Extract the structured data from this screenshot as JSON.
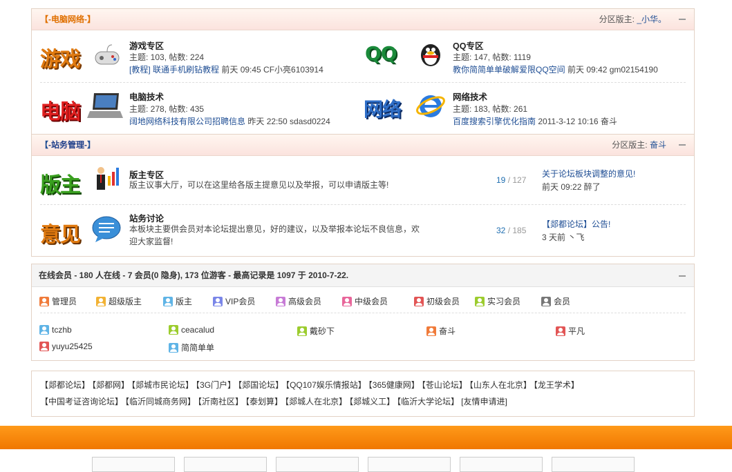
{
  "cat1": {
    "title": "-电脑网络-",
    "moderator_label": "分区版主:",
    "moderator": "_小华。",
    "forums": [
      {
        "icon": "游戏",
        "name": "游戏专区",
        "stats": "主题: 103, 帖数: 224",
        "last_link": "[教程] 联通手机刷钻教程",
        "last_time": "前天 09:45 CF小亮6103914"
      },
      {
        "icon": "QQ",
        "name": "QQ专区",
        "stats": "主题: 147, 帖数: 1119",
        "last_link": "教你简简单单破解爱限QQ空间",
        "last_time": "前天 09:42 gm02154190"
      },
      {
        "icon": "电脑",
        "name": "电脑技术",
        "stats": "主题: 278, 帖数: 435",
        "last_link": "阔地网络科技有限公司招聘信息",
        "last_time": "昨天 22:50 sdasd0224"
      },
      {
        "icon": "网络",
        "name": "网络技术",
        "stats": "主题: 183, 帖数: 261",
        "last_link": "百度搜索引擎优化指南",
        "last_time": "2011-3-12 10:16 奋斗"
      }
    ]
  },
  "cat2": {
    "title": "-站务管理-",
    "moderator_label": "分区版主:",
    "moderator": "奋斗",
    "forums": [
      {
        "icon": "版主",
        "name": "版主专区",
        "desc": "版主议事大厅，可以在这里给各版主提意见以及举报，可以申请版主等!",
        "threads": "19",
        "posts": "127",
        "last_link": "关于论坛板块调整的意见!",
        "last_time": "前天 09:22 醉了"
      },
      {
        "icon": "意见",
        "name": "站务讨论",
        "desc": "本板块主要供会员对本论坛提出意见，好的建议，以及举报本论坛不良信息，欢迎大家监督!",
        "threads": "32",
        "posts": "185",
        "last_link": "【郯都论坛】公告!",
        "last_time": "3 天前 丶飞"
      }
    ]
  },
  "online": {
    "title": "在线会员",
    "summary": " - 180 人在线 - 7 会员(0 隐身), 173 位游客 - 最高记录是 1097 于 2010-7-22.",
    "groups": [
      {
        "label": "管理员",
        "color": "#f07b3a"
      },
      {
        "label": "超级版主",
        "color": "#f2b233"
      },
      {
        "label": "版主",
        "color": "#5fb4e6"
      },
      {
        "label": "VIP会员",
        "color": "#7a86e8"
      },
      {
        "label": "高级会员",
        "color": "#c77bd6"
      },
      {
        "label": "中级会员",
        "color": "#e8669a"
      },
      {
        "label": "初级会员",
        "color": "#e25555"
      },
      {
        "label": "实习会员",
        "color": "#9ccc2e"
      },
      {
        "label": "会员",
        "color": "#777777"
      }
    ],
    "users": [
      {
        "name": "tczhb",
        "color": "#5fb4e6"
      },
      {
        "name": "ceacalud",
        "color": "#9ccc2e"
      },
      {
        "name": "戴砂下",
        "color": "#9ccc2e"
      },
      {
        "name": "奋斗",
        "color": "#f07b3a"
      },
      {
        "name": "平凡",
        "color": "#e25555"
      },
      {
        "name": "yuyu25425",
        "color": "#e25555"
      },
      {
        "name": "简简单单",
        "color": "#5fb4e6"
      }
    ]
  },
  "links": [
    "【郯都论坛】",
    "【郯都网】",
    "【郯城市民论坛】",
    "【3G门户】",
    "【郯国论坛】",
    "【QQ107娱乐情报站】",
    "【365健康网】",
    "【苍山论坛】",
    "【山东人在北京】",
    "【龙王学术】",
    "【中国考证咨询论坛】",
    "【临沂同城商务网】",
    "【沂南社区】",
    "【泰划算】",
    "【郯城人在北京】",
    "【郯城义工】",
    "【临沂大学论坛】",
    "[友情申请进]"
  ]
}
